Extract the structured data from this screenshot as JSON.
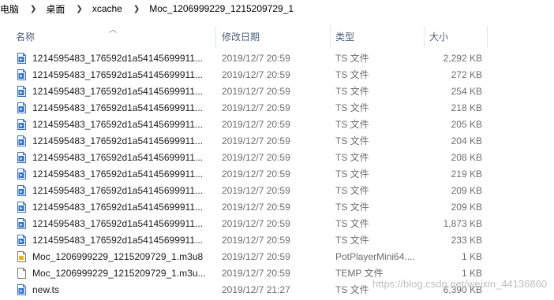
{
  "breadcrumb": [
    {
      "label": "此电脑"
    },
    {
      "label": "桌面"
    },
    {
      "label": "xcache"
    },
    {
      "label": "Moc_1206999229_1215209729_1"
    }
  ],
  "columns": {
    "name": "名称",
    "date": "修改日期",
    "type": "类型",
    "size": "大小"
  },
  "files": [
    {
      "name": "1214595483_176592d1a54145699911...",
      "date": "2019/12/7 20:59",
      "type": "TS 文件",
      "size": "2,292 KB",
      "icon": "ts-file-icon"
    },
    {
      "name": "1214595483_176592d1a54145699911...",
      "date": "2019/12/7 20:59",
      "type": "TS 文件",
      "size": "272 KB",
      "icon": "ts-file-icon"
    },
    {
      "name": "1214595483_176592d1a54145699911...",
      "date": "2019/12/7 20:59",
      "type": "TS 文件",
      "size": "254 KB",
      "icon": "ts-file-icon"
    },
    {
      "name": "1214595483_176592d1a54145699911...",
      "date": "2019/12/7 20:59",
      "type": "TS 文件",
      "size": "218 KB",
      "icon": "ts-file-icon"
    },
    {
      "name": "1214595483_176592d1a54145699911...",
      "date": "2019/12/7 20:59",
      "type": "TS 文件",
      "size": "205 KB",
      "icon": "ts-file-icon"
    },
    {
      "name": "1214595483_176592d1a54145699911...",
      "date": "2019/12/7 20:59",
      "type": "TS 文件",
      "size": "204 KB",
      "icon": "ts-file-icon"
    },
    {
      "name": "1214595483_176592d1a54145699911...",
      "date": "2019/12/7 20:59",
      "type": "TS 文件",
      "size": "208 KB",
      "icon": "ts-file-icon"
    },
    {
      "name": "1214595483_176592d1a54145699911...",
      "date": "2019/12/7 20:59",
      "type": "TS 文件",
      "size": "219 KB",
      "icon": "ts-file-icon"
    },
    {
      "name": "1214595483_176592d1a54145699911...",
      "date": "2019/12/7 20:59",
      "type": "TS 文件",
      "size": "209 KB",
      "icon": "ts-file-icon"
    },
    {
      "name": "1214595483_176592d1a54145699911...",
      "date": "2019/12/7 20:59",
      "type": "TS 文件",
      "size": "209 KB",
      "icon": "ts-file-icon"
    },
    {
      "name": "1214595483_176592d1a54145699911...",
      "date": "2019/12/7 20:59",
      "type": "TS 文件",
      "size": "1,873 KB",
      "icon": "ts-file-icon"
    },
    {
      "name": "1214595483_176592d1a54145699911...",
      "date": "2019/12/7 20:59",
      "type": "TS 文件",
      "size": "233 KB",
      "icon": "ts-file-icon"
    },
    {
      "name": "Moc_1206999229_1215209729_1.m3u8",
      "date": "2019/12/7 20:59",
      "type": "PotPlayerMini64....",
      "size": "1 KB",
      "icon": "m3u8-file-icon"
    },
    {
      "name": "Moc_1206999229_1215209729_1.m3u...",
      "date": "2019/12/7 20:59",
      "type": "TEMP 文件",
      "size": "1 KB",
      "icon": "blank-file-icon"
    },
    {
      "name": "new.ts",
      "date": "2019/12/7 21:27",
      "type": "TS 文件",
      "size": "6,390 KB",
      "icon": "ts-file-icon"
    }
  ],
  "watermark": "https://blog.csdn.net/weixin_44136860",
  "colors": {
    "header_text": "#4c607a",
    "icon_blue": "#2f6fd0",
    "detail_text": "#6d6d6d"
  }
}
